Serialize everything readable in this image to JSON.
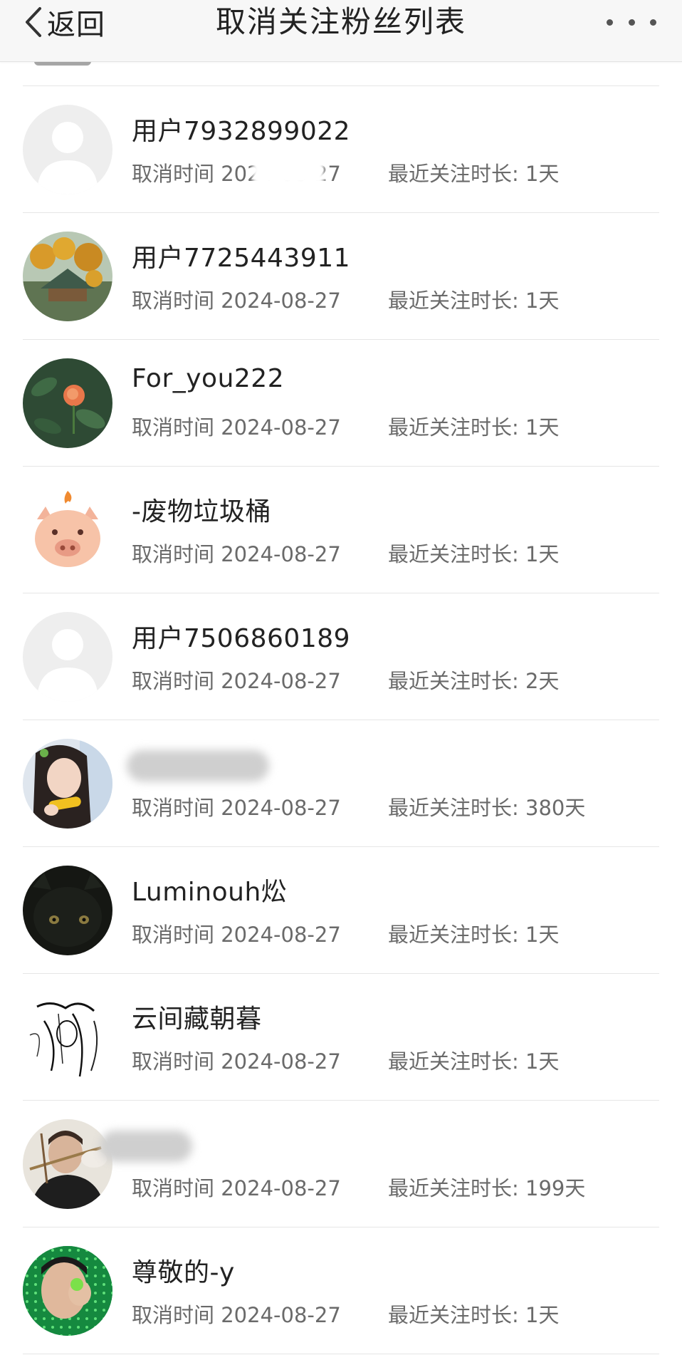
{
  "header": {
    "back_label": "返回",
    "title": "取消关注粉丝列表",
    "more_icon": "more-dots-icon"
  },
  "labels": {
    "cancel_time": "取消时间",
    "recent_duration": "最近关注时长:"
  },
  "rows": [
    {
      "name": "用户7932899022",
      "time": "2024-08-27",
      "duration": "1天",
      "avatar": "default-user"
    },
    {
      "name": "用户7725443911",
      "time": "2024-08-27",
      "duration": "1天",
      "avatar": "pagoda-tree"
    },
    {
      "name": "For_you222",
      "time": "2024-08-27",
      "duration": "1天",
      "avatar": "orange-rose"
    },
    {
      "name": "-废物垃圾桶",
      "time": "2024-08-27",
      "duration": "1天",
      "avatar": "pig-emoji"
    },
    {
      "name": "用户7506860189",
      "time": "2024-08-27",
      "duration": "2天",
      "avatar": "default-user"
    },
    {
      "name": "",
      "time": "2024-08-27",
      "duration": "380天",
      "avatar": "girl-with-corn",
      "name_blurred": true
    },
    {
      "name": "Luminouh炂",
      "time": "2024-08-27",
      "duration": "1天",
      "avatar": "black-cat"
    },
    {
      "name": "云间藏朝暮",
      "time": "2024-08-27",
      "duration": "1天",
      "avatar": "manga-sketch"
    },
    {
      "name": "",
      "time": "2024-08-27",
      "duration": "199天",
      "avatar": "man-with-chopsticks",
      "name_blurred": true
    },
    {
      "name": "尊敬的-y",
      "time": "2024-08-27",
      "duration": "1天",
      "avatar": "crying-man-green"
    }
  ],
  "colors": {
    "header_bg": "#f7f7f7",
    "text_primary": "#222222",
    "text_secondary": "#6a6a6a",
    "divider": "#e6e6e6"
  }
}
